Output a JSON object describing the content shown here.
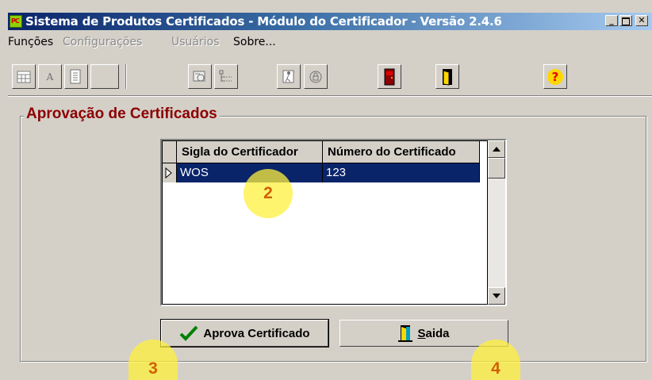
{
  "window": {
    "title": "Sistema de Produtos Certificados - Módulo do Certificador - Versão 2.4.6",
    "icon_text": "PC",
    "controls": {
      "minimize": "_",
      "maximize": "□",
      "close": "✕"
    }
  },
  "menu": {
    "items": [
      {
        "label": "Funções",
        "enabled": true
      },
      {
        "label": "Configurações",
        "enabled": false
      },
      {
        "label": "Usuários",
        "enabled": false
      },
      {
        "label": "Sobre...",
        "enabled": true
      }
    ]
  },
  "toolbar": {
    "buttons": [
      "grid-icon",
      "letter-a-icon",
      "document-list-icon",
      "blank",
      "stamp-icon",
      "tree-list-icon",
      "person-exit-icon",
      "lock-icon",
      "door-closed-icon",
      "door-open-icon",
      "help-icon"
    ],
    "letter": "A",
    "help": "?"
  },
  "group": {
    "title": "Aprovação de Certificados"
  },
  "grid": {
    "columns": [
      "Sigla do Certificador",
      "Número do Certificado"
    ],
    "rows": [
      {
        "sigla": "WOS",
        "numero": "123",
        "selected": true
      }
    ]
  },
  "buttons": {
    "approve": "Aprova Certificado",
    "exit_mnemonic": "S",
    "exit_rest": "aida"
  },
  "badges": {
    "b2": "2",
    "b3": "3",
    "b4": "4"
  },
  "colors": {
    "title_start": "#0a246a",
    "title_end": "#a6caf0",
    "group_title": "#8b0000",
    "selection": "#0a246a",
    "badge": "#fff03c"
  }
}
